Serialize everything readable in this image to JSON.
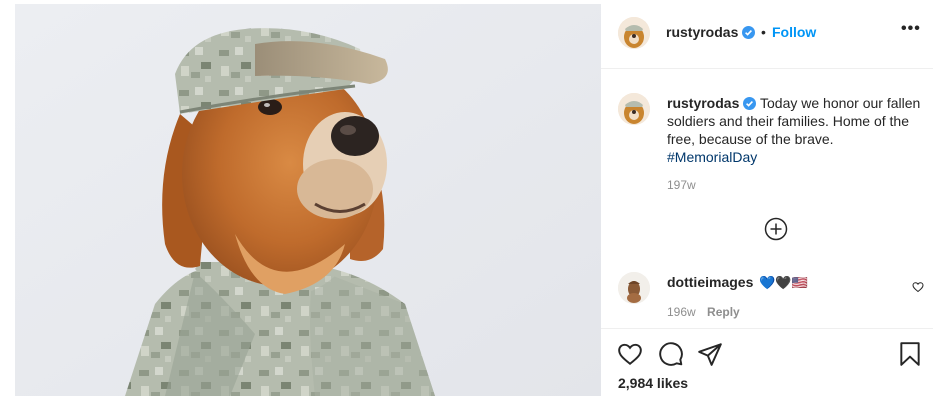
{
  "post": {
    "image_alt": "Golden retriever wearing an army camouflage uniform and cap"
  },
  "header": {
    "username": "rustyrodas",
    "separator": "•",
    "follow_label": "Follow",
    "more_label": "•••",
    "verified_icon": "verified-badge-icon"
  },
  "caption": {
    "username": "rustyrodas",
    "text": "Today we honor our fallen soldiers and their families. Home of the free, because of the brave.",
    "hashtag": "#MemorialDay",
    "time": "197w"
  },
  "load_more_icon": "plus-circle-icon",
  "comments": [
    {
      "username": "dottieimages",
      "emojis": "💙🖤🇺🇸",
      "time": "196w",
      "reply_label": "Reply"
    }
  ],
  "actions": {
    "like_icon": "heart-icon",
    "comment_icon": "comment-bubble-icon",
    "share_icon": "paper-plane-icon",
    "save_icon": "bookmark-icon",
    "likes_text": "2,984 likes"
  },
  "colors": {
    "link_blue": "#0095f6",
    "hashtag": "#00376b",
    "muted": "#8e8e8e",
    "text": "#262626",
    "divider": "#efefef"
  }
}
